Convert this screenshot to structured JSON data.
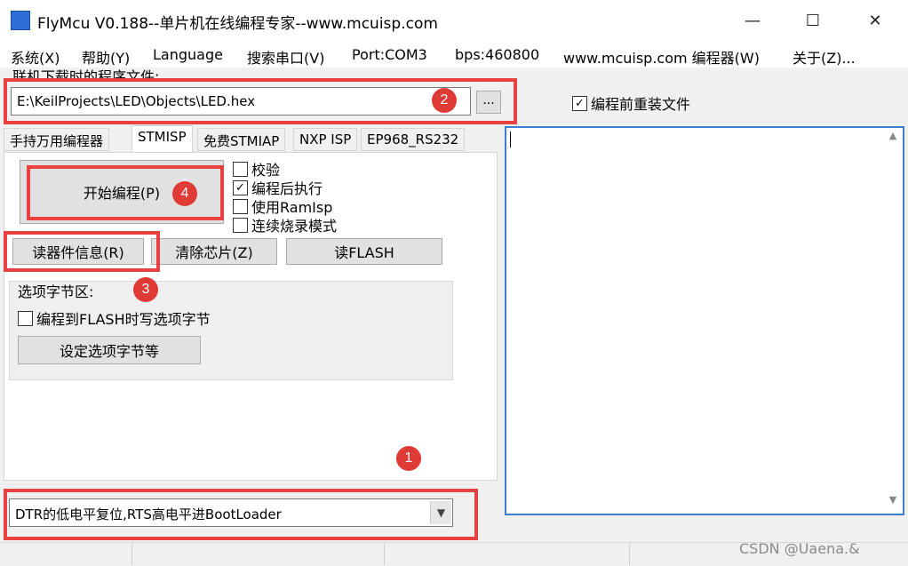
{
  "window": {
    "title": "FlyMcu V0.188--单片机在线编程专家--www.mcuisp.com",
    "minimize": "—",
    "maximize": "☐",
    "close": "✕"
  },
  "menu": [
    "系统(X)",
    "帮助(Y)",
    "Language",
    "搜索串口(V)",
    "Port:COM3",
    "bps:460800",
    "www.mcuisp.com 编程器(W)",
    "关于(Z)..."
  ],
  "file": {
    "caption": "联机下载时的程序文件:",
    "path": "E:\\KeilProjects\\LED\\Objects\\LED.hex",
    "browse_label": "...",
    "reload_label": "编程前重装文件",
    "reload_checked": "✓"
  },
  "tabs": [
    "手持万用编程器",
    "STMISP",
    "免费STMIAP",
    "NXP ISP",
    "EP968_RS232"
  ],
  "stmisp": {
    "start_button": "开始编程(P)",
    "options": [
      {
        "label": "校验",
        "mark": ""
      },
      {
        "label": "编程后执行",
        "mark": "✓"
      },
      {
        "label": "使用RamIsp",
        "mark": ""
      },
      {
        "label": "连续烧录模式",
        "mark": ""
      }
    ],
    "read_info_button": "读器件信息(R)",
    "erase_button": "清除芯片(Z)",
    "read_flash_button": "读FLASH",
    "option_bytes": {
      "title": "选项字节区:",
      "write_checkbox": "编程到FLASH时写选项字节",
      "set_button": "设定选项字节等"
    },
    "reset_mode": "DTR的低电平复位,RTS高电平进BootLoader",
    "combo_arrow": "▼"
  },
  "log": {
    "scroll_up": "▲",
    "scroll_down": "▼"
  },
  "annotations": [
    "1",
    "2",
    "3",
    "4"
  ],
  "watermark": "CSDN @Uaena.&",
  "colors": {
    "highlight": "#e8413f",
    "badge": "#e03a36",
    "log_border": "#3d7fcf"
  }
}
